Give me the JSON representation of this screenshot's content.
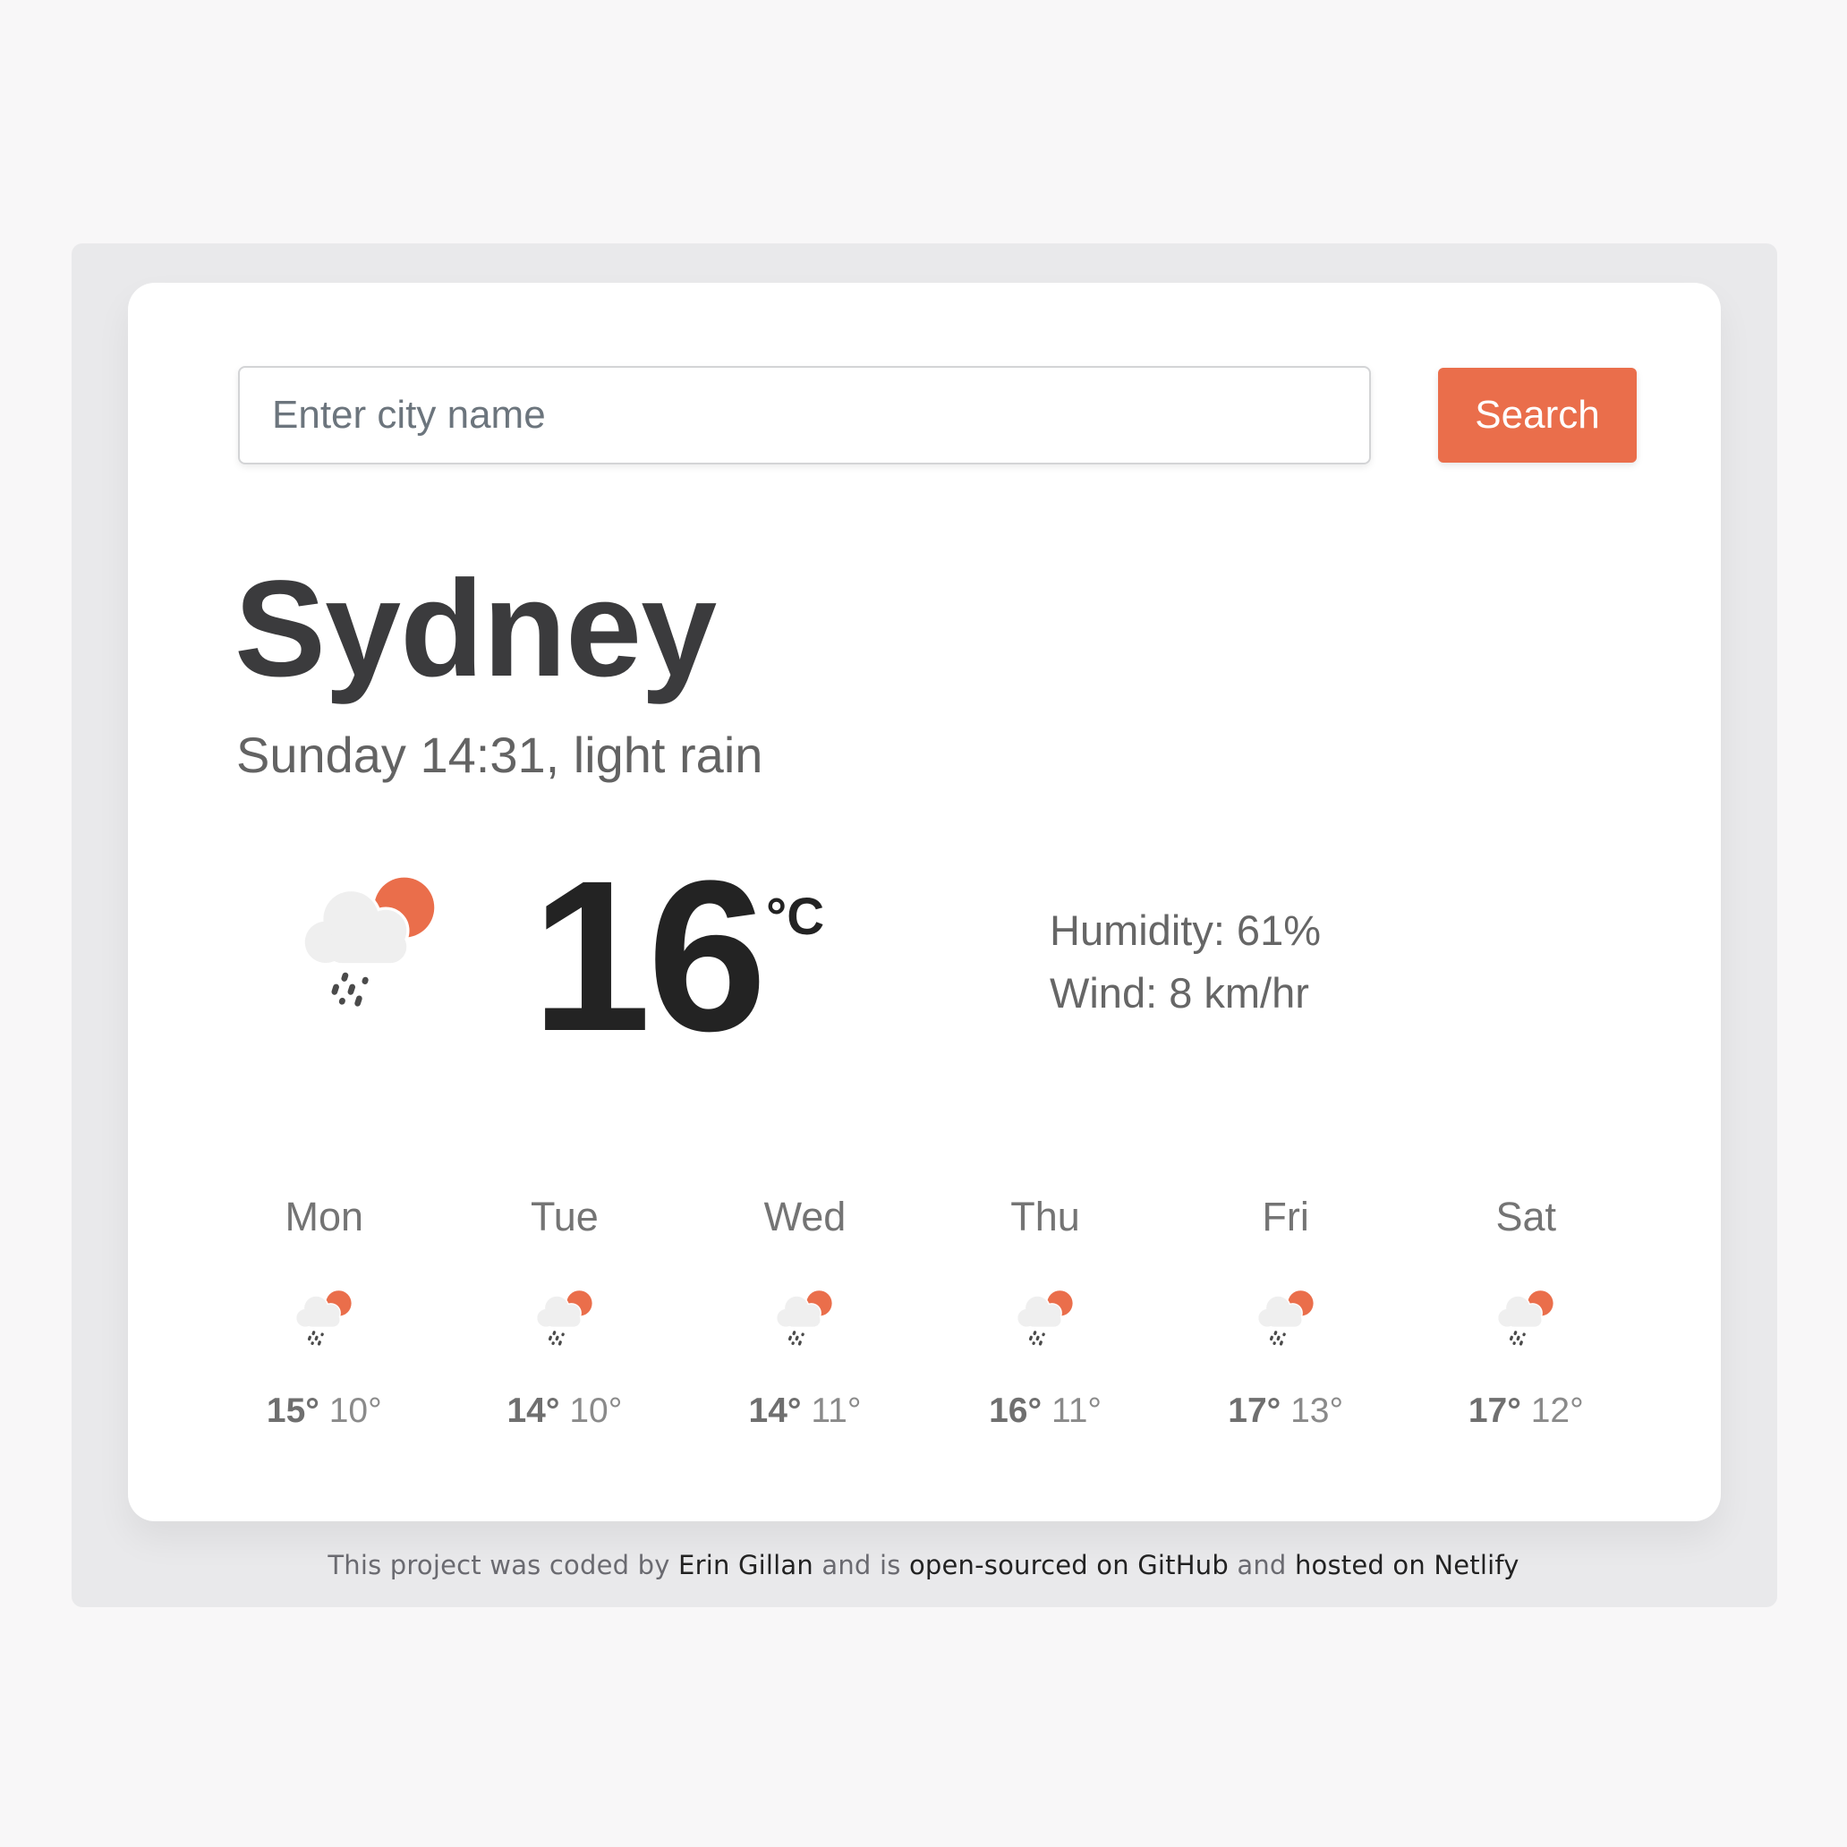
{
  "colors": {
    "accent": "#ea6e4b",
    "cloud": "#efefef",
    "rain": "#4a4a4a"
  },
  "search": {
    "placeholder": "Enter city name",
    "value": "",
    "button_label": "Search"
  },
  "current": {
    "city": "Sydney",
    "description_line": "Sunday 14:31, light rain",
    "icon": "partly-cloudy-rain-icon",
    "temperature": "16",
    "unit": "°C",
    "humidity_text": "Humidity: 61%",
    "wind_text": "Wind: 8 km/hr"
  },
  "forecast": [
    {
      "day": "Mon",
      "icon": "partly-cloudy-rain-icon",
      "max": "15°",
      "min": "10°"
    },
    {
      "day": "Tue",
      "icon": "partly-cloudy-rain-icon",
      "max": "14°",
      "min": "10°"
    },
    {
      "day": "Wed",
      "icon": "partly-cloudy-rain-icon",
      "max": "14°",
      "min": "11°"
    },
    {
      "day": "Thu",
      "icon": "partly-cloudy-rain-icon",
      "max": "16°",
      "min": "11°"
    },
    {
      "day": "Fri",
      "icon": "partly-cloudy-rain-icon",
      "max": "17°",
      "min": "13°"
    },
    {
      "day": "Sat",
      "icon": "partly-cloudy-rain-icon",
      "max": "17°",
      "min": "12°"
    }
  ],
  "footer": {
    "text_1": "This project was coded by ",
    "link_author": "Erin Gillan",
    "text_2": " and is ",
    "link_github": "open-sourced on GitHub",
    "text_3": " and ",
    "link_netlify": "hosted on Netlify"
  }
}
